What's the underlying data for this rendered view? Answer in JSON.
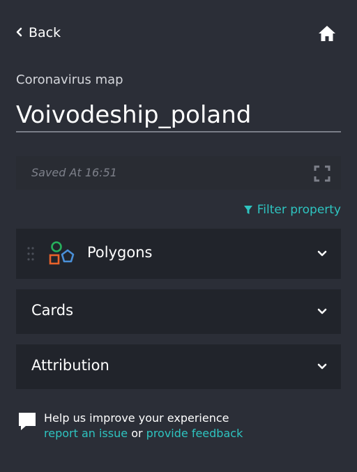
{
  "header": {
    "back_label": "Back"
  },
  "map": {
    "subtitle": "Coronavirus map",
    "title": "Voivodeship_poland",
    "saved_text": "Saved At 16:51"
  },
  "filter": {
    "label": "Filter property"
  },
  "panels": [
    {
      "label": "Polygons"
    },
    {
      "label": "Cards"
    },
    {
      "label": "Attribution"
    }
  ],
  "feedback": {
    "prompt": "Help us improve your experience",
    "report_link": "report an issue",
    "or": "or",
    "feedback_link": "provide feedback"
  },
  "colors": {
    "background": "#2b2e37",
    "panel": "#21242b",
    "accent": "#2ec4c0",
    "polygon_green": "#27b05d",
    "polygon_orange": "#e8632b",
    "polygon_blue": "#4a90d9"
  }
}
